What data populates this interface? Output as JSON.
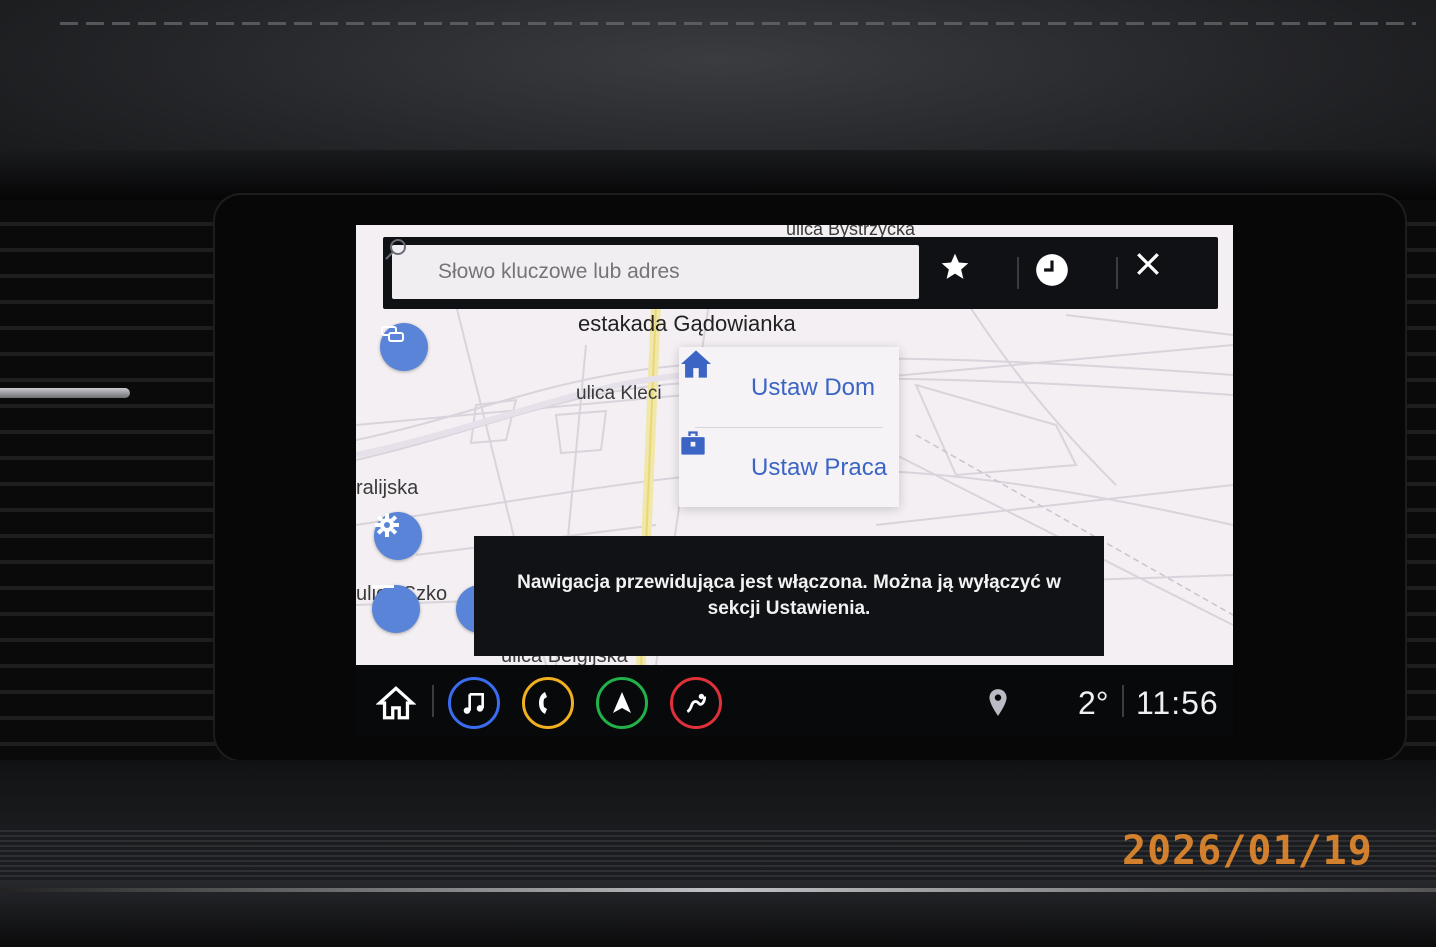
{
  "search": {
    "placeholder": "Słowo kluczowe lub adres"
  },
  "map": {
    "labels": {
      "top": "ulica Bystrzycka",
      "estakada": "estakada Gądowianka",
      "klecina": "ulica Kleci",
      "kral": "ralijska",
      "szko": "ulica Szko",
      "belg": "ulica Belgijska"
    }
  },
  "popup": {
    "home_label": "Ustaw Dom",
    "work_label": "Ustaw Praca"
  },
  "toast": {
    "message": "Nawigacja przewidująca jest włączona. Można ją wyłączyć w sekcji Ustawienia."
  },
  "status": {
    "temperature": "2°",
    "time": "11:56"
  },
  "photo": {
    "date_stamp": "2026/01/19"
  },
  "colors": {
    "accent_blue": "#3b64c4",
    "fab_blue": "#5a84d8",
    "music_ring": "#3a6cf0",
    "phone_ring": "#f0b020",
    "nav_ring": "#22b04a",
    "apps_ring": "#e0303a"
  },
  "icons": {
    "search": "search-icon",
    "favorites": "star-icon",
    "recent": "clock-icon",
    "close": "close-icon",
    "home": "home-icon",
    "work": "briefcase-icon",
    "settings": "gear-icon",
    "zoom_out": "minus-icon",
    "dock_home": "home-icon",
    "dock_music": "music-note-icon",
    "dock_phone": "phone-icon",
    "dock_nav": "navigation-arrow-icon",
    "dock_apps": "apps-icon",
    "location": "location-pin-icon"
  }
}
